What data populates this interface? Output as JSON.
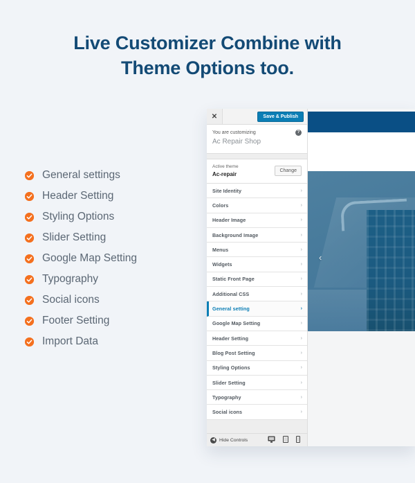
{
  "heading": {
    "line1": "Live Customizer Combine with",
    "line2": "Theme Options too.",
    "color": "#134a75"
  },
  "features": {
    "bullet_color": "#f4701f",
    "text_color": "#5b6774",
    "items": [
      {
        "label": "General settings",
        "icon": "check-circle-icon"
      },
      {
        "label": "Header Setting",
        "icon": "check-circle-icon"
      },
      {
        "label": "Styling Options",
        "icon": "check-circle-icon"
      },
      {
        "label": "Slider Setting",
        "icon": "check-circle-icon"
      },
      {
        "label": "Google Map Setting",
        "icon": "check-circle-icon"
      },
      {
        "label": "Typography",
        "icon": "check-circle-icon"
      },
      {
        "label": "Social icons",
        "icon": "check-circle-icon"
      },
      {
        "label": "Footer Setting",
        "icon": "check-circle-icon"
      },
      {
        "label": "Import Data",
        "icon": "check-circle-icon"
      }
    ]
  },
  "customizer": {
    "close_label": "✕",
    "publish_label": "Save & Publish",
    "publish_color": "#0b7eb5",
    "customizing_label": "You are customizing",
    "customizing_title": "Ac Repair Shop",
    "help_label": "?",
    "active_theme_label": "Active theme",
    "active_theme_name": "Ac-repair",
    "change_label": "Change",
    "menu_items": [
      {
        "label": "Site Identity",
        "active": false
      },
      {
        "label": "Colors",
        "active": false
      },
      {
        "label": "Header Image",
        "active": false
      },
      {
        "label": "Background Image",
        "active": false
      },
      {
        "label": "Menus",
        "active": false
      },
      {
        "label": "Widgets",
        "active": false
      },
      {
        "label": "Static Front Page",
        "active": false
      },
      {
        "label": "Additional CSS",
        "active": false
      },
      {
        "label": "General setting",
        "active": true
      },
      {
        "label": "Google Map Setting",
        "active": false
      },
      {
        "label": "Header Setting",
        "active": false
      },
      {
        "label": "Blog Post Setting",
        "active": false
      },
      {
        "label": "Styling Options",
        "active": false
      },
      {
        "label": "Slider Setting",
        "active": false
      },
      {
        "label": "Typography",
        "active": false
      },
      {
        "label": "Social icons",
        "active": false
      }
    ],
    "chevron": "›",
    "footer": {
      "hide_controls_label": "Hide Controls",
      "collapse_icon": "◀",
      "devices": [
        {
          "name": "desktop-preview-icon",
          "active": true
        },
        {
          "name": "tablet-preview-icon",
          "active": false
        },
        {
          "name": "mobile-preview-icon",
          "active": false
        }
      ]
    }
  },
  "preview": {
    "topbar_color": "#0a4f85",
    "slider_prev_arrow": "‹"
  }
}
